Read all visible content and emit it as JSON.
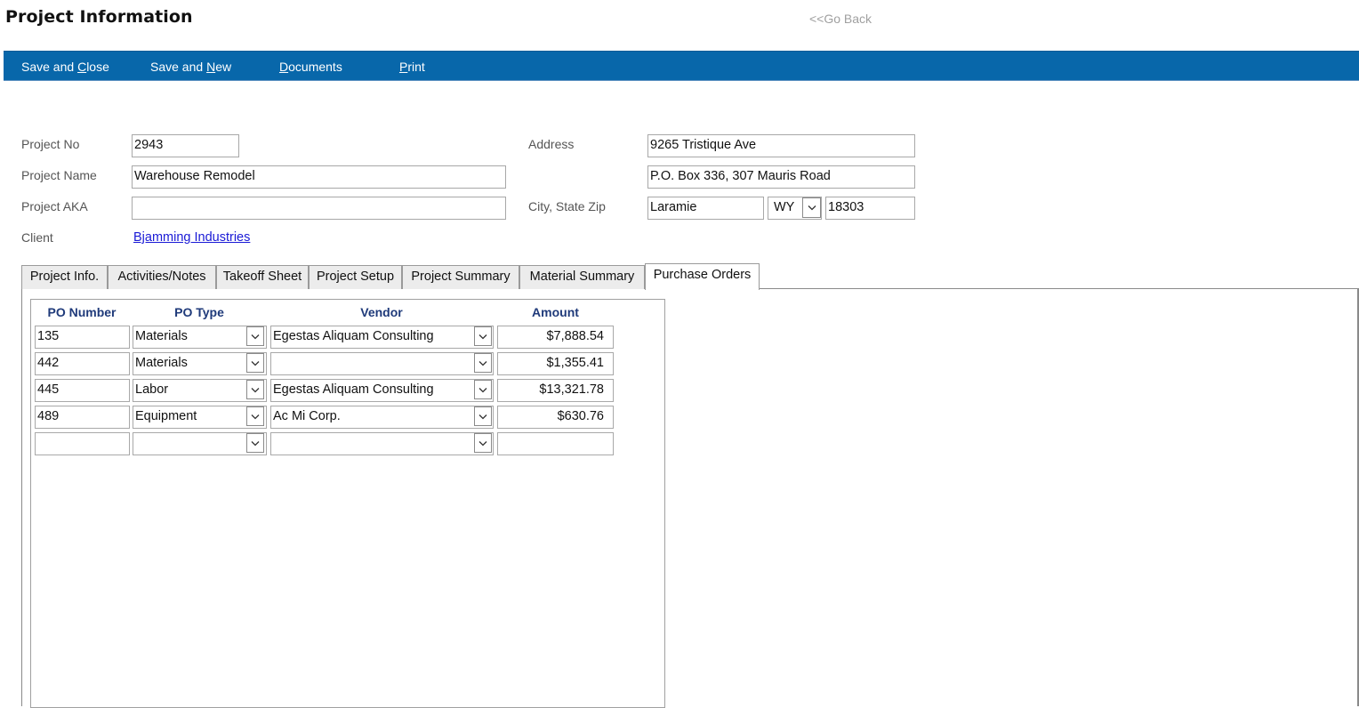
{
  "header": {
    "title": "Project Information",
    "go_back": "<<Go Back"
  },
  "toolbar": {
    "buttons": [
      {
        "pre": "Save and ",
        "key": "C",
        "post": "lose"
      },
      {
        "pre": "Save and ",
        "key": "N",
        "post": "ew"
      },
      {
        "pre": "",
        "key": "D",
        "post": "ocuments"
      },
      {
        "pre": "",
        "key": "P",
        "post": "rint"
      }
    ],
    "color": "#0867aa"
  },
  "form": {
    "project_no_label": "Project No",
    "project_no": "2943",
    "project_name_label": "Project Name",
    "project_name": "Warehouse Remodel",
    "project_aka_label": "Project AKA",
    "project_aka": "",
    "client_label": "Client",
    "client": "Bjamming Industries",
    "address_label": "Address",
    "address1": "9265 Tristique Ave",
    "address2": "P.O. Box 336, 307 Mauris Road",
    "city_state_zip_label": "City, State Zip",
    "city": "Laramie",
    "state": "WY",
    "zip": "18303"
  },
  "tabs": [
    {
      "label": "Project Info.",
      "active": false
    },
    {
      "label": "Activities/Notes",
      "active": false
    },
    {
      "label": "Takeoff Sheet",
      "active": false
    },
    {
      "label": "Project Setup",
      "active": false
    },
    {
      "label": "Project Summary",
      "active": false
    },
    {
      "label": "Material Summary",
      "active": false
    },
    {
      "label": "Purchase Orders",
      "active": true
    }
  ],
  "purchase_orders": {
    "columns": [
      "PO Number",
      "PO Type",
      "Vendor",
      "Amount"
    ],
    "rows": [
      {
        "po_number": "135",
        "po_type": "Materials",
        "vendor": "Egestas Aliquam Consulting",
        "amount": "$7,888.54"
      },
      {
        "po_number": "442",
        "po_type": "Materials",
        "vendor": "",
        "amount": "$1,355.41"
      },
      {
        "po_number": "445",
        "po_type": "Labor",
        "vendor": "Egestas Aliquam Consulting",
        "amount": "$13,321.78"
      },
      {
        "po_number": "489",
        "po_type": "Equipment",
        "vendor": "Ac Mi Corp.",
        "amount": "$630.76"
      },
      {
        "po_number": "",
        "po_type": "",
        "vendor": "",
        "amount": ""
      }
    ]
  }
}
